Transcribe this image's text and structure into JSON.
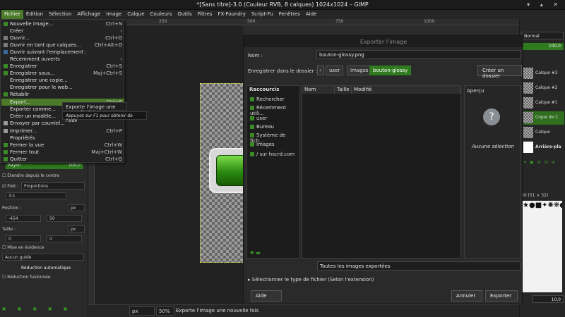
{
  "window": {
    "title": "*[Sans titre]-3.0 (Couleur RVB, 8 calques) 1024x1024 – GIMP",
    "controls": "▾ ▴ ✕"
  },
  "menubar": [
    "Fichier",
    "Édition",
    "Sélection",
    "Affichage",
    "Image",
    "Calque",
    "Couleurs",
    "Outils",
    "Filtres",
    "FX-Foundry",
    "Script-Fu",
    "Fenêtres",
    "Aide"
  ],
  "file_menu": {
    "items": [
      {
        "label": "Nouvelle image...",
        "shortcut": "Ctrl+N"
      },
      {
        "label": "Créer",
        "shortcut": "›"
      },
      {
        "label": "Ouvrir...",
        "shortcut": "Ctrl+O"
      },
      {
        "label": "Ouvrir en tant que calques...",
        "shortcut": "Ctrl+Alt+O"
      },
      {
        "label": "Ouvrir suivant l'emplacement :",
        "shortcut": ""
      },
      {
        "label": "Récemment ouverts",
        "shortcut": "›"
      },
      {
        "label": "Enregistrer",
        "shortcut": "Ctrl+S"
      },
      {
        "label": "Enregistrer sous...",
        "shortcut": "Maj+Ctrl+S"
      },
      {
        "label": "Enregistrer une copie...",
        "shortcut": ""
      },
      {
        "label": "Enregistrer pour le web...",
        "shortcut": ""
      },
      {
        "label": "Rétablir",
        "shortcut": ""
      },
      {
        "label": "Export...",
        "shortcut": "Ctrl+E"
      },
      {
        "label": "Exporter comme...",
        "shortcut": ""
      },
      {
        "label": "Créer un modèle...",
        "shortcut": ""
      },
      {
        "label": "Envoyer par courriel...",
        "shortcut": ""
      },
      {
        "label": "Imprimer...",
        "shortcut": "Ctrl+P"
      },
      {
        "label": "Propriétés",
        "shortcut": ""
      },
      {
        "label": "Fermer la vue",
        "shortcut": "Ctrl+W"
      },
      {
        "label": "Fermer tout",
        "shortcut": "Maj+Ctrl+W"
      },
      {
        "label": "Quitter",
        "shortcut": "Ctrl+Q"
      }
    ],
    "submenu_text": "Exporte l'image une nouvelle fois",
    "tooltip": "Appuyez sur F1 pour obtenir de l'aide"
  },
  "toolbox": {
    "rayon_label": "Rayon",
    "rayon_value": "100,0",
    "grow_from_center": "Étendre depuis le centre",
    "fixed_label": "Fixé :",
    "fixed_value": "Proportions",
    "ratio": "3:1",
    "position_label": "Position :",
    "position_unit": "px",
    "pos_x": "-454",
    "pos_y": "50",
    "size_label": "Taille :",
    "size_unit": "px",
    "size_w": "0",
    "size_h": "0",
    "highlight": "Mise en évidence",
    "guide": "Aucun guide",
    "auto_shrink": "Réduction automatique",
    "shrink_merged": "Réduction fusionnée"
  },
  "ruler_marks": [
    "250",
    "500",
    "750",
    "1000"
  ],
  "statusbar": {
    "unit": "px",
    "zoom": "50%",
    "message": "Exporte l'image une nouvelle fois"
  },
  "export_dialog": {
    "title": "Exporter l'image",
    "name_label": "Nom :",
    "name_value": "bouton-glossy.png",
    "folder_label": "Enregistrer dans le dossier :",
    "crumbs": [
      "user",
      "Images",
      "bouton-glossy"
    ],
    "create_folder": "Créer un dossier",
    "places_header": "Raccourcis",
    "places": [
      "Rechercher",
      "Récemment utili...",
      "user",
      "Bureau",
      "Système de fich...",
      "Images",
      "/ sur hscrd.com"
    ],
    "columns": [
      "Nom",
      "Taille",
      "Modifié"
    ],
    "preview_header": "Aperçu",
    "no_selection": "Aucune sélection",
    "filter": "Toutes les images exportées",
    "file_type": "Sélectionner le type de fichier (Selon l'extension)",
    "help": "Aide",
    "cancel": "Annuler",
    "export": "Exporter"
  },
  "layers_dock": {
    "mode": "Normal",
    "opacity": "100,0",
    "layers": [
      "Calque #3",
      "Calque #2",
      "Calque #1",
      "Copie de C",
      "Calque",
      "Arrière-pla"
    ],
    "brush": "50 (51 × 52)",
    "spacing": "10,0"
  }
}
